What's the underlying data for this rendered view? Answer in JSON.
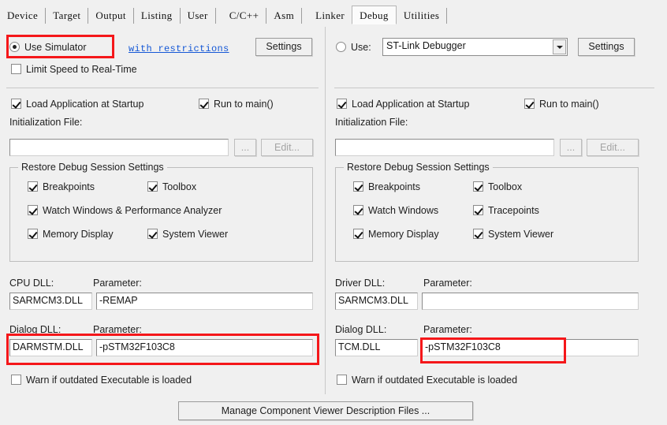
{
  "tabs": [
    {
      "label": "Device",
      "selected": false
    },
    {
      "label": "Target",
      "selected": false
    },
    {
      "label": "Output",
      "selected": false
    },
    {
      "label": "Listing",
      "selected": false
    },
    {
      "label": "User",
      "selected": false
    },
    {
      "label": "C/C++",
      "selected": false
    },
    {
      "label": "Asm",
      "selected": false
    },
    {
      "label": "Linker",
      "selected": false
    },
    {
      "label": "Debug",
      "selected": true
    },
    {
      "label": "Utilities",
      "selected": false
    }
  ],
  "simulator": {
    "radio_label": "Use Simulator",
    "radio_selected": true,
    "restrictions_link": "with restrictions",
    "settings_button": "Settings",
    "limit_speed_label": "Limit Speed to Real-Time",
    "limit_speed_checked": false,
    "load_app_label": "Load Application at Startup",
    "load_app_checked": true,
    "run_to_main_label": "Run to main()",
    "run_to_main_checked": true,
    "init_file_label": "Initialization File:",
    "init_file_value": "",
    "browse_button": "...",
    "edit_button": "Edit...",
    "restore_group_title": "Restore Debug Session Settings",
    "restore_items": [
      {
        "label": "Breakpoints",
        "checked": true
      },
      {
        "label": "Toolbox",
        "checked": true
      },
      {
        "label": "Watch Windows & Performance Analyzer",
        "checked": true
      },
      {
        "label": "Memory Display",
        "checked": true
      },
      {
        "label": "System Viewer",
        "checked": true
      }
    ],
    "cpu_dll_label": "CPU DLL:",
    "cpu_dll_value": "SARMCM3.DLL",
    "cpu_param_label": "Parameter:",
    "cpu_param_value": "-REMAP",
    "dialog_dll_label": "Dialog DLL:",
    "dialog_dll_value": "DARMSTM.DLL",
    "dialog_param_label": "Parameter:",
    "dialog_param_value": "-pSTM32F103C8",
    "warn_label": "Warn if outdated Executable is loaded",
    "warn_checked": false
  },
  "debugger": {
    "radio_label": "Use:",
    "radio_selected": false,
    "driver_selected": "ST-Link Debugger",
    "settings_button": "Settings",
    "load_app_label": "Load Application at Startup",
    "load_app_checked": true,
    "run_to_main_label": "Run to main()",
    "run_to_main_checked": true,
    "init_file_label": "Initialization File:",
    "init_file_value": "",
    "browse_button": "...",
    "edit_button": "Edit...",
    "restore_group_title": "Restore Debug Session Settings",
    "restore_items": [
      {
        "label": "Breakpoints",
        "checked": true
      },
      {
        "label": "Toolbox",
        "checked": true
      },
      {
        "label": "Watch Windows",
        "checked": true
      },
      {
        "label": "Tracepoints",
        "checked": true
      },
      {
        "label": "Memory Display",
        "checked": true
      },
      {
        "label": "System Viewer",
        "checked": true
      }
    ],
    "driver_dll_label": "Driver DLL:",
    "driver_dll_value": "SARMCM3.DLL",
    "driver_param_label": "Parameter:",
    "driver_param_value": "",
    "dialog_dll_label": "Dialog DLL:",
    "dialog_dll_value": "TCM.DLL",
    "dialog_param_label": "Parameter:",
    "dialog_param_value": "-pSTM32F103C8",
    "warn_label": "Warn if outdated Executable is loaded",
    "warn_checked": false
  },
  "footer": {
    "manage_button": "Manage Component Viewer Description Files ..."
  },
  "colors": {
    "annotation": "#f5171a",
    "link": "#1558d6",
    "dialog_bg": "#f0f0f0"
  }
}
